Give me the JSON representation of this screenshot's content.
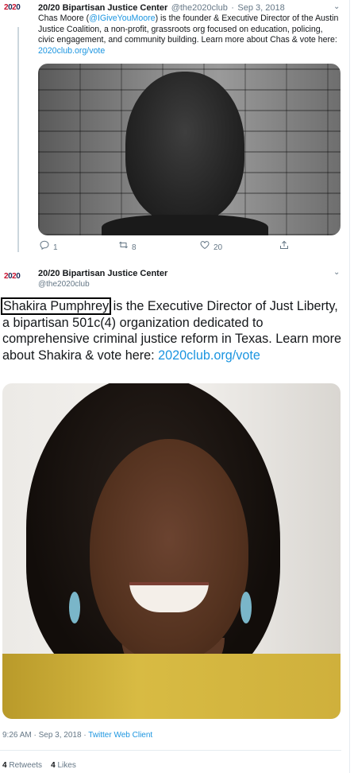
{
  "tweet1": {
    "name": "20/20 Bipartisan Justice Center",
    "handle": "@the2020club",
    "separator": "·",
    "date": "Sep 3, 2018",
    "text_before": "Chas Moore (",
    "mention": "@IGiveYouMoore",
    "text_after": ") is the founder & Executive Director of the Austin Justice Coalition, a non-profit, grassroots org focused on education, policing, civic engagement, and community building. Learn more about Chas & vote here: ",
    "link": "2020club.org/vote",
    "replies": "1",
    "retweets": "8",
    "likes": "20"
  },
  "tweet2": {
    "name": "20/20 Bipartisan Justice Center",
    "handle": "@the2020club",
    "highlight": "Shakira Pumphrey",
    "text_after": " is the Executive Director of Just Liberty, a bipartisan 501c(4) organization dedicated to comprehensive criminal justice reform in Texas. Learn more about Shakira & vote here: ",
    "link": "2020club.org/vote",
    "time": "9:26 AM",
    "date": "Sep 3, 2018",
    "client": "Twitter Web Client",
    "retweets_count": "4",
    "retweets_label": "Retweets",
    "likes_count": "4",
    "likes_label": "Likes"
  },
  "logo": {
    "text_r": "2",
    "text_b": "0",
    "text_r2": "2",
    "text_b2": "0"
  },
  "icons": {
    "reply": "reply-icon",
    "retweet": "retweet-icon",
    "like": "heart-icon",
    "share": "share-icon",
    "caret": "chevron-down-icon"
  },
  "colors": {
    "link": "#1b95e0",
    "muted": "#657786",
    "text": "#14171a"
  }
}
